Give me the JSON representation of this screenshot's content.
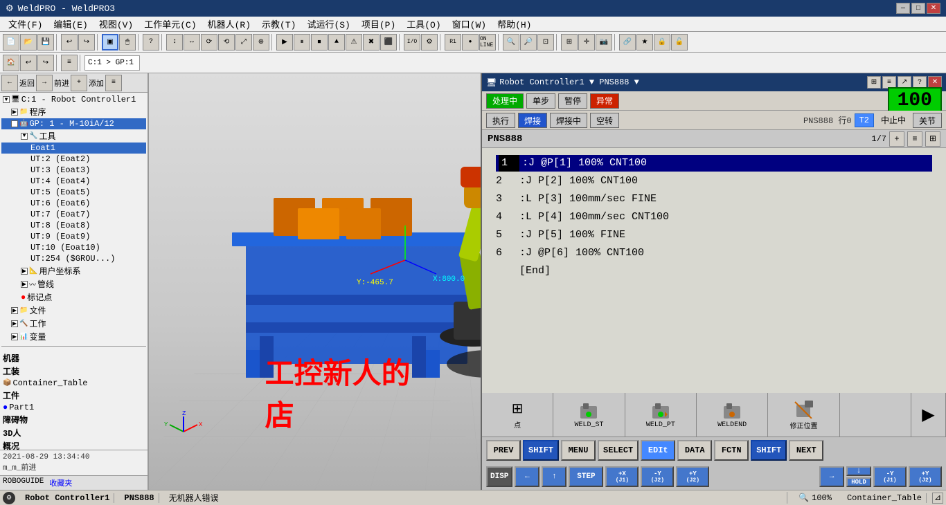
{
  "titlebar": {
    "title": "WeldPRO - WeldPRO3",
    "icon": "⚙",
    "controls": [
      "—",
      "□",
      "✕"
    ]
  },
  "menubar": {
    "items": [
      "文件(F)",
      "编辑(E)",
      "视图(V)",
      "工作单元(C)",
      "机器人(R)",
      "示教(T)",
      "试运行(S)",
      "项目(P)",
      "工具(O)",
      "窗口(W)",
      "帮助(H)"
    ]
  },
  "left_panel": {
    "nav": [
      "返回",
      "前进",
      "添加"
    ],
    "tree": [
      {
        "label": "C:1 - Robot Controller1",
        "level": 0,
        "type": "controller",
        "selected": false
      },
      {
        "label": "程序",
        "level": 1,
        "type": "folder"
      },
      {
        "label": "GP: 1 - M-10iA/12",
        "level": 1,
        "type": "robot",
        "selected": true
      },
      {
        "label": "工具",
        "level": 2,
        "type": "folder"
      },
      {
        "label": "Eoat1",
        "level": 3,
        "type": "tool",
        "selected": true
      },
      {
        "label": "UT:2  (Eoat2)",
        "level": 3,
        "type": "tool"
      },
      {
        "label": "UT:3  (Eoat3)",
        "level": 3,
        "type": "tool"
      },
      {
        "label": "UT:4  (Eoat4)",
        "level": 3,
        "type": "tool"
      },
      {
        "label": "UT:5  (Eoat5)",
        "level": 3,
        "type": "tool"
      },
      {
        "label": "UT:6  (Eoat6)",
        "level": 3,
        "type": "tool"
      },
      {
        "label": "UT:7  (Eoat7)",
        "level": 3,
        "type": "tool"
      },
      {
        "label": "UT:8  (Eoat8)",
        "level": 3,
        "type": "tool"
      },
      {
        "label": "UT:9  (Eoat9)",
        "level": 3,
        "type": "tool"
      },
      {
        "label": "UT:10 (Eoat10)",
        "level": 3,
        "type": "tool"
      },
      {
        "label": "UT:254 ($GROU...)",
        "level": 3,
        "type": "tool"
      },
      {
        "label": "用户坐标系",
        "level": 2,
        "type": "folder"
      },
      {
        "label": "管线",
        "level": 2,
        "type": "folder"
      },
      {
        "label": "标记点",
        "level": 2,
        "type": "marker"
      },
      {
        "label": "文件",
        "level": 1,
        "type": "folder"
      },
      {
        "label": "工作",
        "level": 1,
        "type": "folder"
      },
      {
        "label": "变量",
        "level": 1,
        "type": "folder"
      }
    ],
    "sections": [
      {
        "label": "机器"
      },
      {
        "label": "工装"
      },
      {
        "label": "Container_Table"
      },
      {
        "label": "工件"
      },
      {
        "label": "Part1"
      },
      {
        "label": "障碍物"
      },
      {
        "label": "3D人"
      },
      {
        "label": "概况"
      }
    ],
    "date": "2021-08-29 13:34:40",
    "footer_label": "ROBOGUIDE  收藏夹"
  },
  "rc_window": {
    "title": "Robot Controller1 ▼  PNS888 ▼",
    "status_row": {
      "buttons": [
        "处理中",
        "单步",
        "暂停",
        "异常"
      ]
    },
    "cmd_row": {
      "buttons": [
        "执行",
        "焊接",
        "焊接中",
        "空转"
      ],
      "pns_info": "PNS888  行0",
      "t2_label": "T2",
      "status": "中止中",
      "close_btn": "关节"
    },
    "program_name": "PNS888",
    "page_info": "1/7",
    "number_display": "100",
    "program_lines": [
      {
        "num": "1",
        "content": ":J @P[1]  100% CNT100",
        "current": true
      },
      {
        "num": "2",
        "content": ":J  P[2]  100% CNT100",
        "current": false
      },
      {
        "num": "3",
        "content": ":L  P[3]  100mm/sec FINE",
        "current": false
      },
      {
        "num": "4",
        "content": ":L  P[4]  100mm/sec CNT100",
        "current": false
      },
      {
        "num": "5",
        "content": ":J  P[5]  100% FINE",
        "current": false
      },
      {
        "num": "6",
        "content": ":J @P[6]  100% CNT100",
        "current": false
      },
      {
        "num": "",
        "content": "[End]",
        "current": false
      }
    ],
    "icon_buttons": [
      {
        "icon": "⊞",
        "label": "点"
      },
      {
        "icon": "🤖",
        "label": "WELD_ST"
      },
      {
        "icon": "🤖",
        "label": "WELD_PT"
      },
      {
        "icon": "🤖",
        "label": "WELDEND"
      },
      {
        "icon": "📐",
        "label": "修正位置"
      },
      {
        "icon": "",
        "label": ""
      }
    ],
    "arrow_btn": "▶",
    "key_row1": [
      "PREV",
      "SHIFT",
      "MENU",
      "SELECT",
      "EDIt",
      "DATA",
      "FCTN",
      "SHIFT",
      "NEXT"
    ],
    "key_row2": [
      "DISP",
      "←",
      "↑",
      "→",
      "STEP",
      "+X (J1)",
      "-Y (J2)",
      "+Y (J2)"
    ],
    "key_row2b": [
      "↓",
      "HOLD",
      "-Y (J1)",
      "+Y (J2)"
    ]
  },
  "viewport": {
    "watermark": "工控新人的店",
    "date": "2021-08-29 13:34:40",
    "label": "m_m_前进"
  },
  "statusbar": {
    "robot": "Robot Controller1",
    "program": "PNS888",
    "message": "无机器人错误",
    "zoom": "100%",
    "object": "Container_Table"
  }
}
